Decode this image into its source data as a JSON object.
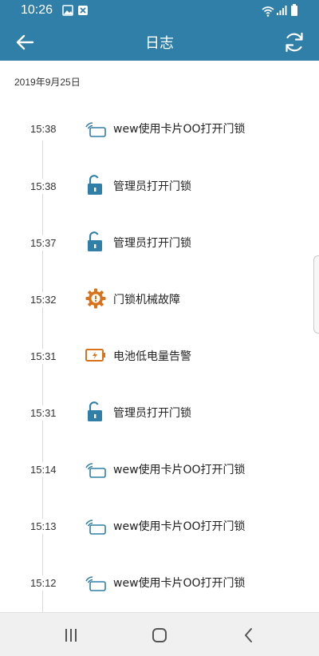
{
  "status_bar": {
    "time": "10:26",
    "icons": [
      "image-icon",
      "close-box-icon",
      "wifi-icon",
      "signal-icon",
      "battery-icon"
    ]
  },
  "app_bar": {
    "title": "日志",
    "back_icon": "arrow-left-icon",
    "refresh_icon": "refresh-icon",
    "color": "#2f7fa8"
  },
  "log": {
    "date": "2019年9月25日",
    "entries": [
      {
        "time": "15:38",
        "icon": "card-icon",
        "text": "wew使用卡片OO打开门锁"
      },
      {
        "time": "15:38",
        "icon": "unlock-icon",
        "text": "管理员打开门锁"
      },
      {
        "time": "15:37",
        "icon": "unlock-icon",
        "text": "管理员打开门锁"
      },
      {
        "time": "15:32",
        "icon": "gear-warning-icon",
        "text": "门锁机械故障"
      },
      {
        "time": "15:31",
        "icon": "battery-low-icon",
        "text": "电池低电量告警"
      },
      {
        "time": "15:31",
        "icon": "unlock-icon",
        "text": "管理员打开门锁"
      },
      {
        "time": "15:14",
        "icon": "card-icon",
        "text": "wew使用卡片OO打开门锁"
      },
      {
        "time": "15:13",
        "icon": "card-icon",
        "text": "wew使用卡片OO打开门锁"
      },
      {
        "time": "15:12",
        "icon": "card-icon",
        "text": "wew使用卡片OO打开门锁"
      }
    ]
  },
  "nav_bar": {
    "buttons": [
      "recent-apps-icon",
      "home-icon",
      "back-icon"
    ]
  },
  "colors": {
    "accent": "#2f7fa8",
    "warning": "#d9731b"
  }
}
